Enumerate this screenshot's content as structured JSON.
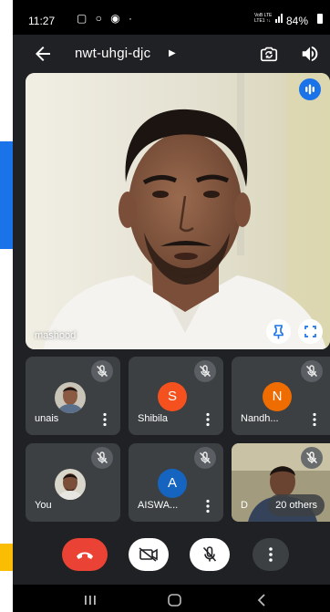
{
  "status_bar": {
    "time": "11:27",
    "notification_icons": "▢ ○ ◉ ·",
    "network": "VoB LTE\nLTE1 ↑↓",
    "battery": "84%"
  },
  "top_bar": {
    "meeting_code": "nwt-uhgi-djc"
  },
  "main_video": {
    "participant_name": "mashood"
  },
  "participants": [
    {
      "name": "unais",
      "avatar": "photo",
      "muted": true
    },
    {
      "name": "Shibila",
      "avatar": "letter",
      "letter": "S",
      "avatar_color": "#f4511e",
      "muted": true
    },
    {
      "name": "Nandh...",
      "avatar": "letter",
      "letter": "N",
      "avatar_color": "#ef6c00",
      "muted": true
    },
    {
      "name": "You",
      "avatar": "photo",
      "muted": true
    },
    {
      "name": "AISWA...",
      "avatar": "letter",
      "letter": "A",
      "avatar_color": "#1565c0",
      "muted": true
    },
    {
      "name": "D",
      "avatar": "video",
      "muted": true,
      "overflow_label": "20 others"
    }
  ],
  "controls": {
    "end_call": "end-call",
    "camera": "camera-off",
    "mic": "mic-off",
    "more": "more-options"
  },
  "colors": {
    "end_call": "#ea4335",
    "accent": "#1a73e8",
    "tile_background": "#3c4043",
    "app_background": "#202124"
  }
}
